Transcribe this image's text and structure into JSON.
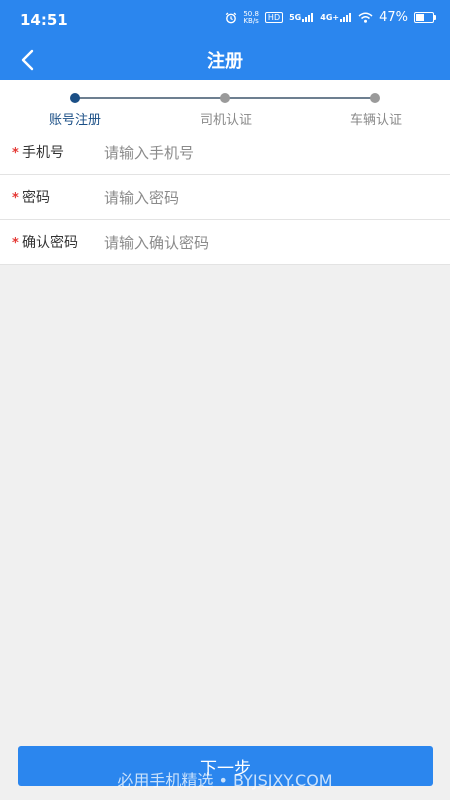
{
  "status_bar": {
    "time": "14:51",
    "net_speed": "50.8",
    "net_unit": "KB/s",
    "hd": "HD",
    "sig1": "5G",
    "sig2": "4G+",
    "battery_pct": "47%",
    "battery_level": 0.47
  },
  "header": {
    "title": "注册"
  },
  "steps": [
    {
      "label": "账号注册",
      "active": true
    },
    {
      "label": "司机认证",
      "active": false
    },
    {
      "label": "车辆认证",
      "active": false
    }
  ],
  "form": {
    "required_mark": "*",
    "fields": [
      {
        "label": "手机号",
        "placeholder": "请输入手机号"
      },
      {
        "label": "密码",
        "placeholder": "请输入密码"
      },
      {
        "label": "确认密码",
        "placeholder": "请输入确认密码"
      }
    ]
  },
  "next_button": "下一步",
  "watermark": "必用手机精选 • BYJSJXY.COM",
  "colors": {
    "primary": "#2b86ee",
    "active_step": "#1b4f86",
    "inactive_step": "#9a9a9a",
    "required": "#e53935"
  }
}
